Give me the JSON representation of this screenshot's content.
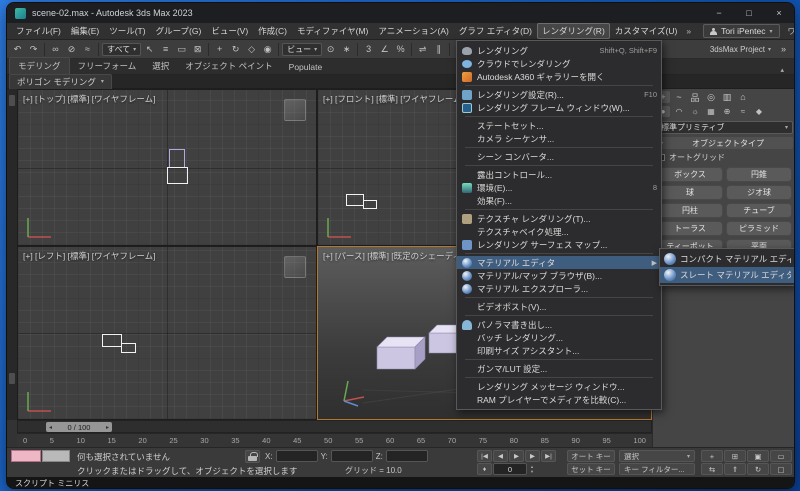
{
  "colors": {
    "menu_highlight": "#3f5d7e",
    "active_viewport_border": "#b5772f",
    "macro_recorder_pink": "#eeb7c6",
    "desktop_blue": "#1258b8"
  },
  "window": {
    "title": "scene-02.max - Autodesk 3ds Max 2023",
    "controls": {
      "minimize": "−",
      "maximize": "□",
      "close": "×"
    }
  },
  "menubar": {
    "items": [
      "ファイル(F)",
      "編集(E)",
      "ツール(T)",
      "グループ(G)",
      "ビュー(V)",
      "作成(C)",
      "モディファイヤ(M)",
      "アニメーション(A)",
      "グラフ エディタ(D)",
      "レンダリング(R)",
      "カスタマイズ(U)"
    ],
    "open_index": 9,
    "overflow": "»",
    "user": "Tori iPentec",
    "workspace": "ワークスペース: 既定値"
  },
  "toolbar": {
    "project_label": "3dsMax Project",
    "items": [
      {
        "icon": "undo-icon",
        "glyph": "↶"
      },
      {
        "icon": "redo-icon",
        "glyph": "↷"
      },
      {
        "sep": true
      },
      {
        "icon": "select-and-link-icon",
        "glyph": "∞"
      },
      {
        "icon": "unlink-selection-icon",
        "glyph": "⊘"
      },
      {
        "icon": "bind-to-space-warp-icon",
        "glyph": "≈"
      },
      {
        "sep": true
      },
      {
        "dropdown": "すべて",
        "name": "selection-filter-dropdown"
      },
      {
        "icon": "select-object-icon",
        "glyph": "↖"
      },
      {
        "icon": "select-by-name-icon",
        "glyph": "≡"
      },
      {
        "icon": "rectangular-selection-region-icon",
        "glyph": "▭"
      },
      {
        "icon": "window-crossing-toggle-icon",
        "glyph": "⊠"
      },
      {
        "sep": true
      },
      {
        "icon": "select-and-move-icon",
        "glyph": "+"
      },
      {
        "icon": "select-and-rotate-icon",
        "glyph": "↻"
      },
      {
        "icon": "select-and-scale-icon",
        "glyph": "◇"
      },
      {
        "icon": "select-and-place-icon",
        "glyph": "◉"
      },
      {
        "sep": true
      },
      {
        "dropdown": "ビュー",
        "name": "reference-coordinate-system-dropdown"
      },
      {
        "icon": "use-pivot-point-center-icon",
        "glyph": "⊙"
      },
      {
        "icon": "select-and-manipulate-icon",
        "glyph": "∗"
      },
      {
        "sep": true
      },
      {
        "icon": "snaps-toggle-icon",
        "glyph": "3"
      },
      {
        "icon": "angle-snap-toggle-icon",
        "glyph": "∠"
      },
      {
        "icon": "percent-snap-toggle-icon",
        "glyph": "%"
      },
      {
        "sep": true
      },
      {
        "icon": "mirror-icon",
        "glyph": "⇌"
      },
      {
        "icon": "align-icon",
        "glyph": "∥"
      },
      {
        "sep": true
      },
      {
        "icon": "toggle-scene-explorer-icon",
        "glyph": "▤"
      },
      {
        "icon": "toggle-layer-explorer-icon",
        "glyph": "▦"
      },
      {
        "icon": "curve-editor-icon",
        "glyph": "~"
      },
      {
        "sep": true
      },
      {
        "icon": "material-editor-icon",
        "glyph": ""
      },
      {
        "icon": "render-setup-icon",
        "glyph": ""
      },
      {
        "icon": "rendered-frame-window-icon",
        "glyph": "▢"
      },
      {
        "icon": "render-production-icon",
        "glyph": ""
      }
    ],
    "right_icons": [
      {
        "icon": "toolbar-overflow-icon",
        "glyph": "»"
      }
    ]
  },
  "ribbon": {
    "tabs": [
      "モデリング",
      "フリーフォーム",
      "選択",
      "オブジェクト ペイント",
      "Populate"
    ],
    "subtab": "ポリゴン モデリング"
  },
  "viewports": {
    "top": {
      "label": "[+] [トップ] [標準] [ワイヤフレーム]"
    },
    "front": {
      "label": "[+] [フロント] [標準] [ワイヤフレーム]"
    },
    "left": {
      "label": "[+] [レフト] [標準] [ワイヤフレーム]"
    },
    "persp": {
      "label": "[+] [パース] [標準] [既定のシェーディング]"
    }
  },
  "render_menu": {
    "items": [
      {
        "type": "item",
        "label": "レンダリング",
        "shortcut": "Shift+Q, Shift+F9",
        "icon": "render-teapot-icon"
      },
      {
        "type": "item",
        "label": "クラウドでレンダリング",
        "icon": "cloud-render-icon"
      },
      {
        "type": "item",
        "label": "Autodesk A360 ギャラリーを開く",
        "icon": "a360-gallery-icon"
      },
      {
        "type": "separator"
      },
      {
        "type": "item",
        "label": "レンダリング設定(R)...",
        "shortcut": "F10",
        "icon": "render-setup-icon"
      },
      {
        "type": "item",
        "label": "レンダリング フレーム ウィンドウ(W)...",
        "icon": "render-frame-window-icon"
      },
      {
        "type": "separator"
      },
      {
        "type": "item",
        "label": "ステートセット..."
      },
      {
        "type": "item",
        "label": "カメラ シーケンサ..."
      },
      {
        "type": "separator"
      },
      {
        "type": "item",
        "label": "シーン コンバータ..."
      },
      {
        "type": "separator"
      },
      {
        "type": "item",
        "label": "露出コントロール..."
      },
      {
        "type": "item",
        "label": "環境(E)...",
        "shortcut": "8",
        "icon": "environment-icon"
      },
      {
        "type": "item",
        "label": "効果(F)..."
      },
      {
        "type": "separator"
      },
      {
        "type": "item",
        "label": "テクスチャ レンダリング(T)...",
        "icon": "texture-render-icon"
      },
      {
        "type": "item",
        "label": "テクスチャベイク処理..."
      },
      {
        "type": "item",
        "label": "レンダリング サーフェス マップ...",
        "icon": "surface-map-icon"
      },
      {
        "type": "separator"
      },
      {
        "type": "item",
        "label": "マテリアル エディタ",
        "icon": "material-editor-icon",
        "submenu": true,
        "highlighted": true
      },
      {
        "type": "item",
        "label": "マテリアル/マップ ブラウザ(B)...",
        "icon": "material-map-browser-icon"
      },
      {
        "type": "item",
        "label": "マテリアル エクスプローラ...",
        "icon": "material-explorer-icon"
      },
      {
        "type": "separator"
      },
      {
        "type": "item",
        "label": "ビデオポスト(V)..."
      },
      {
        "type": "separator"
      },
      {
        "type": "item",
        "label": "パノラマ書き出し...",
        "icon": "panorama-icon"
      },
      {
        "type": "item",
        "label": "バッチ レンダリング..."
      },
      {
        "type": "item",
        "label": "印刷サイズ アシスタント..."
      },
      {
        "type": "separator"
      },
      {
        "type": "item",
        "label": "ガンマ/LUT 設定..."
      },
      {
        "type": "separator"
      },
      {
        "type": "item",
        "label": "レンダリング メッセージ ウィンドウ..."
      },
      {
        "type": "item",
        "label": "RAM プレイヤーでメディアを比較(C)..."
      }
    ]
  },
  "material_submenu": {
    "items": [
      {
        "label": "コンパクト マテリアル エディタ...",
        "icon": "compact-material-editor-icon",
        "highlighted": false
      },
      {
        "label": "スレート マテリアル エディタ...",
        "icon": "slate-material-editor-icon",
        "highlighted": true
      }
    ]
  },
  "command_panel": {
    "panel_tabs": [
      {
        "name": "create-tab-icon",
        "glyph": "+"
      },
      {
        "name": "modify-tab-icon",
        "glyph": "~"
      },
      {
        "name": "hierarchy-tab-icon",
        "glyph": "品"
      },
      {
        "name": "motion-tab-icon",
        "glyph": "◎"
      },
      {
        "name": "display-tab-icon",
        "glyph": "▥"
      },
      {
        "name": "utilities-tab-icon",
        "glyph": "⌂"
      }
    ],
    "category_icons": [
      {
        "name": "geometry-category-icon",
        "glyph": "●"
      },
      {
        "name": "shapes-category-icon",
        "glyph": "◠"
      },
      {
        "name": "lights-category-icon",
        "glyph": "☼"
      },
      {
        "name": "cameras-category-icon",
        "glyph": "▦"
      },
      {
        "name": "helpers-category-icon",
        "glyph": "⊕"
      },
      {
        "name": "space-warps-category-icon",
        "glyph": "≈"
      },
      {
        "name": "systems-category-icon",
        "glyph": "◆"
      }
    ],
    "category_dropdown": "標準プリミティブ",
    "object_type_rollout": "オブジェクトタイプ",
    "autogrid_label": "オートグリッド",
    "buttons": [
      "ボックス",
      "円錐",
      "球",
      "ジオ球",
      "円柱",
      "チューブ",
      "トーラス",
      "ピラミッド",
      "ティーポット",
      "平面"
    ]
  },
  "timeline": {
    "slider_label": "0 / 100",
    "ticks": [
      "0",
      "5",
      "10",
      "15",
      "20",
      "25",
      "30",
      "35",
      "40",
      "45",
      "50",
      "55",
      "60",
      "65",
      "70",
      "75",
      "80",
      "85",
      "90",
      "95",
      "100"
    ]
  },
  "status_bar": {
    "selection_status": "何も選択されていません",
    "prompt": "クリックまたはドラッグして、オブジェクトを選択します",
    "grid_label": "グリッド = 10.0",
    "coords": [
      {
        "label": "X:"
      },
      {
        "label": "Y:"
      },
      {
        "label": "Z:"
      }
    ],
    "frame_value": "0",
    "key_mode_glyph": "♦",
    "auto_key": "オート キー",
    "set_key": "セット キー",
    "selection_set_label": "選択",
    "key_filters_label": "キー フィルター...",
    "mini_listener_label": "スクリプト ミニリス",
    "playback": [
      {
        "name": "go-to-start-button",
        "glyph": "|◀"
      },
      {
        "name": "previous-frame-button",
        "glyph": "◀"
      },
      {
        "name": "play-animation-button",
        "glyph": "▶"
      },
      {
        "name": "next-frame-button",
        "glyph": "▶"
      },
      {
        "name": "go-to-end-button",
        "glyph": "▶|"
      }
    ],
    "nav": [
      {
        "name": "zoom-icon",
        "glyph": "+"
      },
      {
        "name": "zoom-all-icon",
        "glyph": "⊞"
      },
      {
        "name": "zoom-extents-icon",
        "glyph": "▣"
      },
      {
        "name": "zoom-region-icon",
        "glyph": "▭"
      },
      {
        "name": "pan-icon",
        "glyph": "⇆"
      },
      {
        "name": "walk-through-icon",
        "glyph": "⇑"
      },
      {
        "name": "orbit-icon",
        "glyph": "↻"
      },
      {
        "name": "maximize-viewport-toggle-icon",
        "glyph": "▢"
      }
    ]
  }
}
